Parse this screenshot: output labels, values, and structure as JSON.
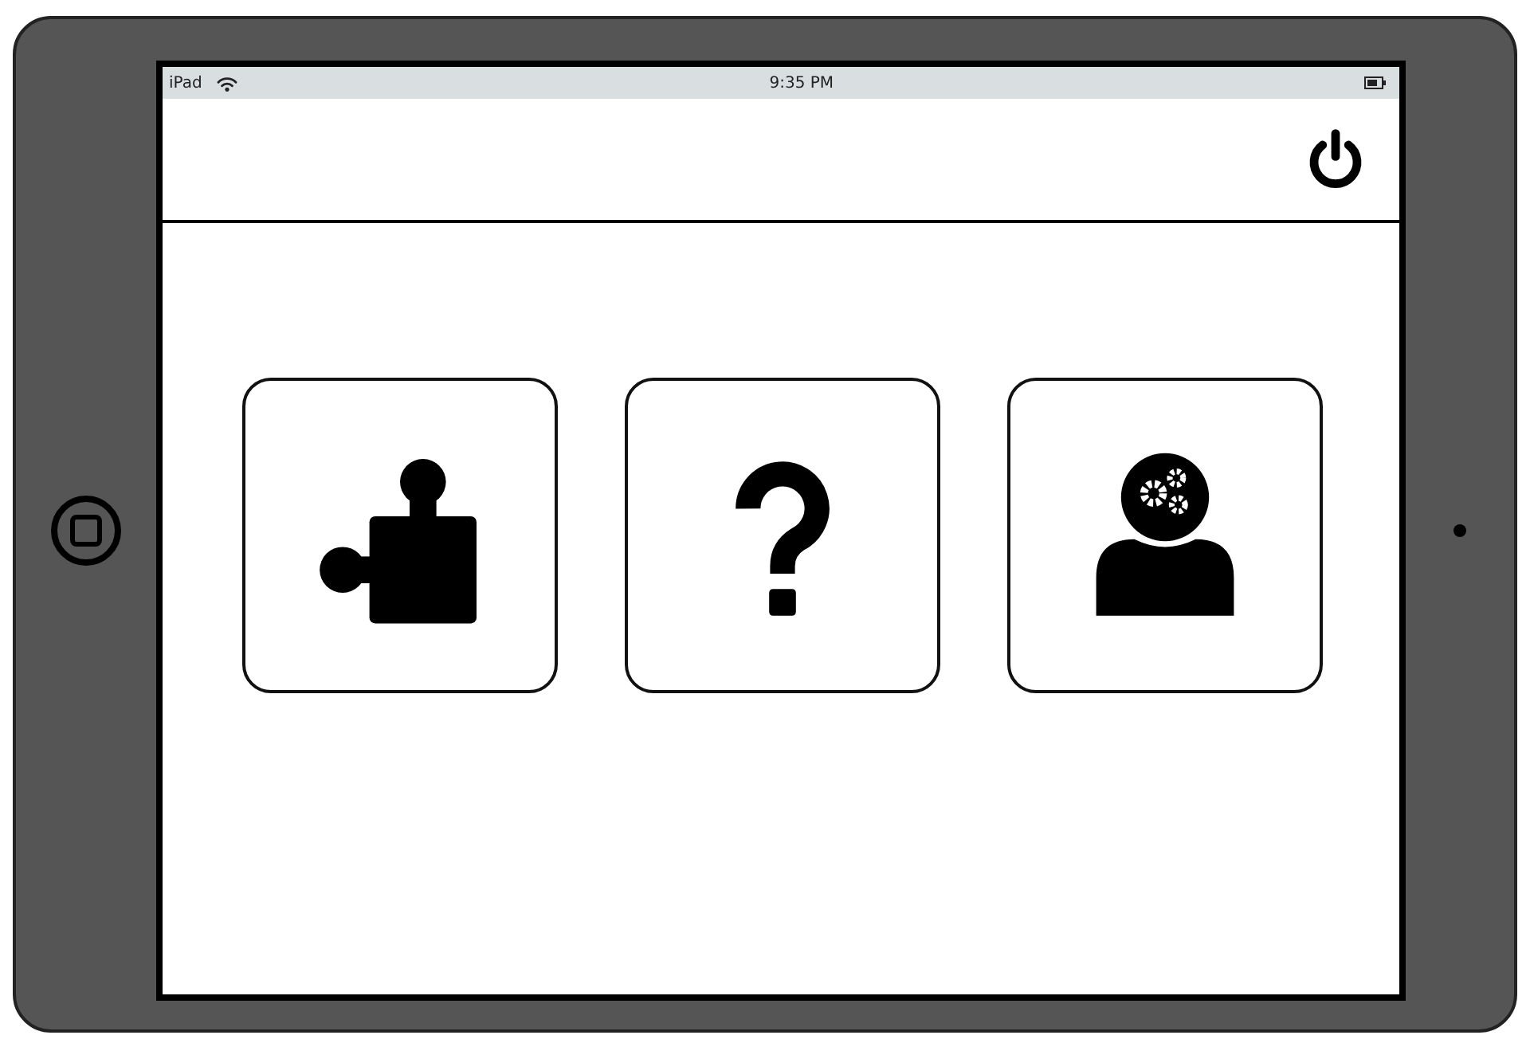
{
  "status_bar": {
    "carrier": "iPad",
    "time": "9:35 PM"
  },
  "tiles": [
    {
      "kind": "puzzle"
    },
    {
      "kind": "help"
    },
    {
      "kind": "user-settings"
    }
  ]
}
